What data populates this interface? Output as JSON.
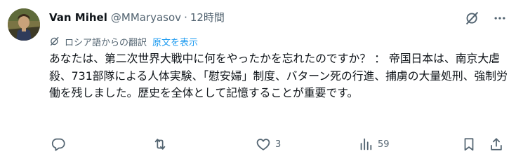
{
  "tweet": {
    "display_name": "Van Mihel",
    "handle": "@MMaryasov",
    "separator": "·",
    "time": "12時間",
    "translation_note": "ロシア語からの翻訳",
    "show_original": "原文を表示",
    "body": "あなたは、第二次世界大戦中に何をやったかを忘れたのですか？ ： 帝国日本は、南京大虐殺、731部隊による人体実験、「慰安婦」制度、バターン死の行進、捕虜の大量処刑、強制労働を残しました。歴史を全体として記憶することが重要です。"
  },
  "actions": {
    "reply_count": "",
    "retweet_count": "",
    "like_count": "3",
    "views_count": "59"
  },
  "icons": {
    "grok": "grok-icon",
    "more": "more-icon",
    "translate": "translate-icon",
    "reply": "reply-icon",
    "retweet": "retweet-icon",
    "like": "heart-icon",
    "views": "views-icon",
    "bookmark": "bookmark-icon",
    "share": "share-icon"
  },
  "colors": {
    "text": "#0f1419",
    "secondary": "#536471",
    "link": "#1d9bf0",
    "background": "#ffffff"
  }
}
